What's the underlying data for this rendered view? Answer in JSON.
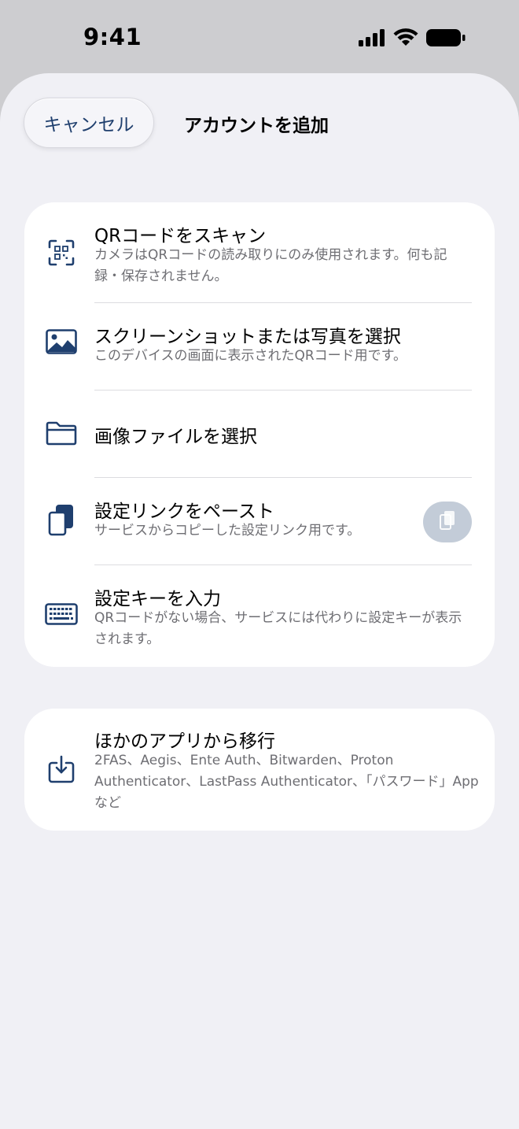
{
  "status_bar": {
    "time": "9:41"
  },
  "header": {
    "cancel_label": "キャンセル",
    "title": "アカウントを追加"
  },
  "options": [
    {
      "icon": "qr-code-scan-icon",
      "title": "QRコードをスキャン",
      "subtitle": "カメラはQRコードの読み取りにのみ使用されます。何も記録・保存されません。"
    },
    {
      "icon": "photo-icon",
      "title": "スクリーンショットまたは写真を選択",
      "subtitle": "このデバイスの画面に表示されたQRコード用です。"
    },
    {
      "icon": "folder-icon",
      "title": "画像ファイルを選択",
      "subtitle": ""
    },
    {
      "icon": "paste-icon",
      "title": "設定リンクをペースト",
      "subtitle": "サービスからコピーした設定リンク用です。"
    },
    {
      "icon": "keyboard-icon",
      "title": "設定キーを入力",
      "subtitle": "QRコードがない場合、サービスには代わりに設定キーが表示されます。"
    }
  ],
  "migrate": {
    "icon": "import-icon",
    "title": "ほかのアプリから移行",
    "subtitle": "2FAS、Aegis、Ente Auth、Bitwarden、Proton Authenticator、LastPass Authenticator、「パスワード」Appなど"
  },
  "colors": {
    "accent": "#1f3f6e",
    "sheet_background": "#f0f0f5",
    "card_background": "#ffffff",
    "secondary_text": "#6e6e73",
    "paste_button": "#c3ccd8"
  }
}
